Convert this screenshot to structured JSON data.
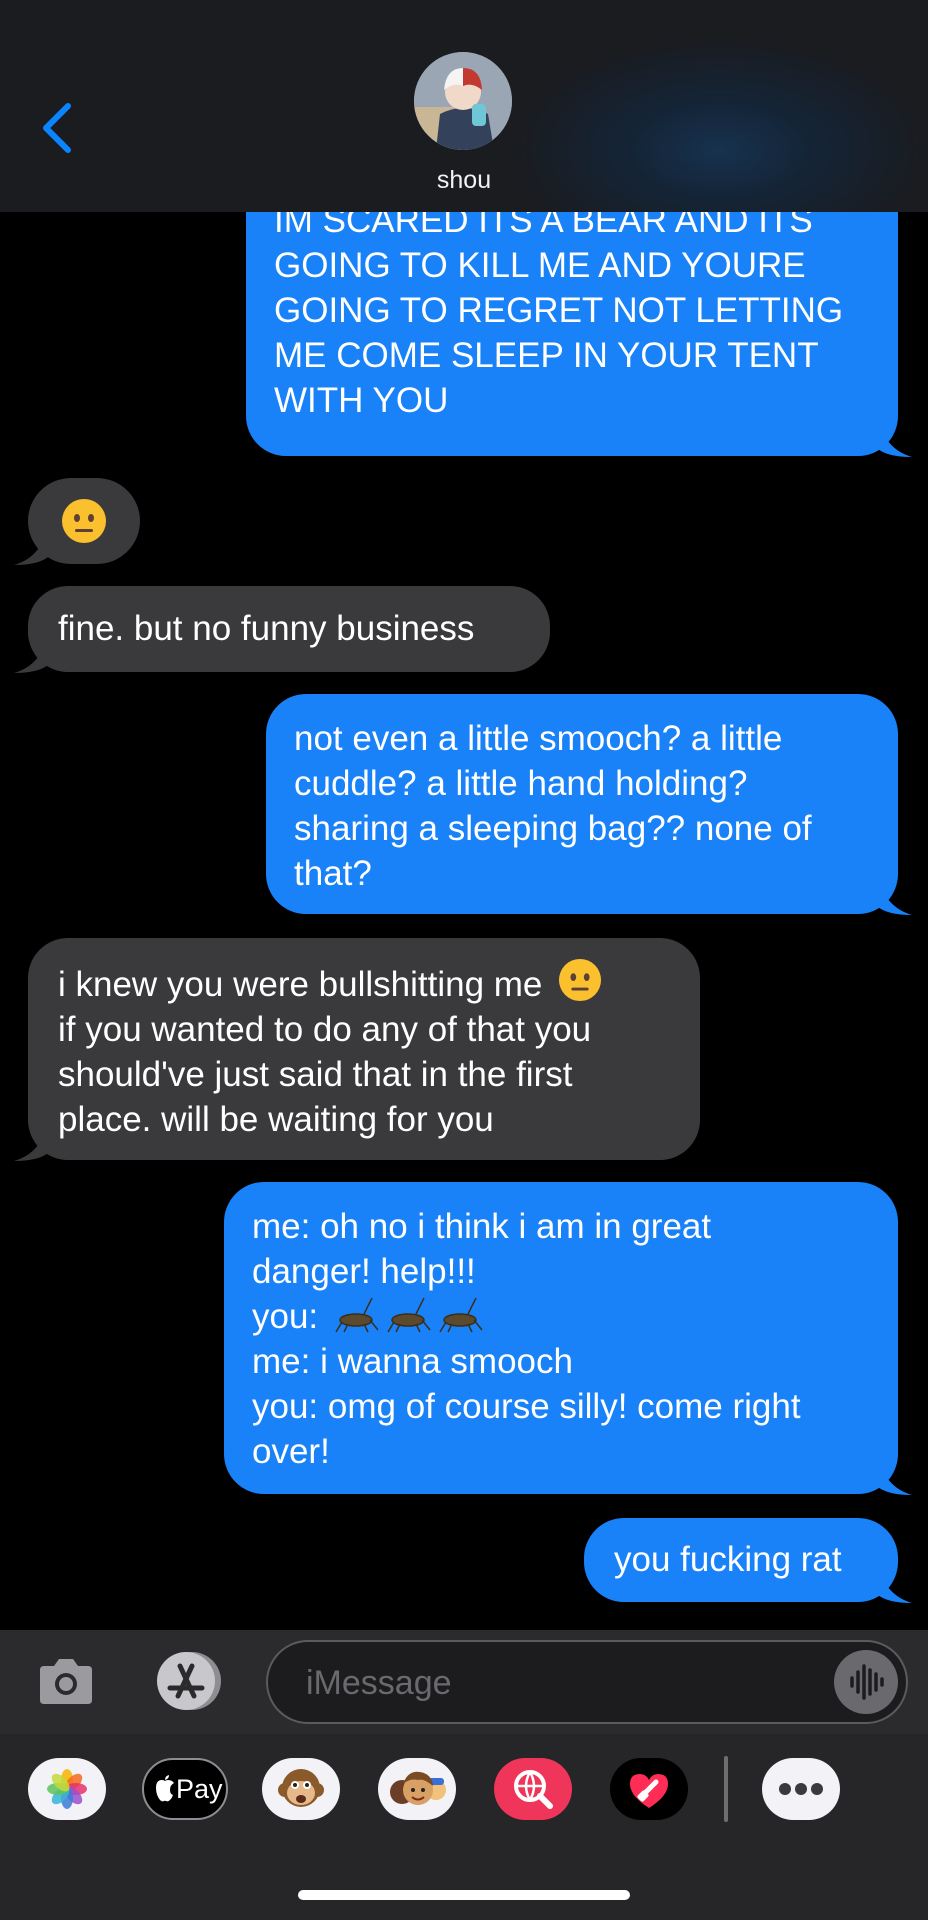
{
  "header": {
    "contact_name": "shou"
  },
  "messages": [
    {
      "from": "me",
      "text": "IM SCARED ITS A BEAR AND ITS\nGOING TO KILL ME AND YOURE\nGOING TO REGRET NOT LETTING\nME COME SLEEP IN YOUR TENT\nWITH YOU"
    },
    {
      "from": "them",
      "emoji": "neutral-face"
    },
    {
      "from": "them",
      "text": "fine. but no funny business"
    },
    {
      "from": "me",
      "text": "not even a little smooch? a little\ncuddle? a little hand holding?\nsharing a sleeping bag?? none of\nthat?"
    },
    {
      "from": "them",
      "text_line1": "i knew you were bullshitting me",
      "text_rest": "if you wanted to do any of that you\nshould've just said that in the first\nplace. will be waiting for you",
      "emoji": "neutral-face"
    },
    {
      "from": "me",
      "line1": "me: oh no i think i am in great",
      "line2": "danger! help!!!",
      "line3": "you:",
      "line3_emoji": "cricket x3",
      "line4": "me: i wanna smooch",
      "line5": "you: omg of course silly! come right",
      "line6": "over!"
    },
    {
      "from": "me",
      "text": "you fucking rat"
    }
  ],
  "input": {
    "placeholder": "iMessage"
  },
  "app_drawer": {
    "apps": [
      "photos-icon",
      "apple-pay",
      "memoji-monkey",
      "memoji-stickers",
      "search-images",
      "digital-touch"
    ],
    "apple_pay_label": "Pay",
    "more": "more-icon"
  },
  "colors": {
    "sent_bubble": "#1982f8",
    "received_bubble": "#3a3a3c",
    "accent": "#0a84ff"
  }
}
